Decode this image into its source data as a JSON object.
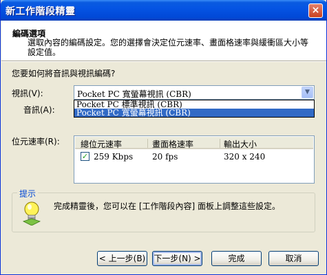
{
  "window": {
    "title": "新工作階段精靈",
    "close_glyph": "×"
  },
  "header": {
    "title": "編碼選項",
    "description": "選取內容的編碼設定。您的選擇會決定位元速率、畫面格速率與緩衝區大小等設定值。"
  },
  "question": "您要如何將音訊與視訊編碼?",
  "video": {
    "label": "視訊(V):",
    "selected": "Pocket PC 寬螢幕視訊 (CBR)",
    "options": [
      "Pocket PC 標準視訊 (CBR)",
      "Pocket PC 寬螢幕視訊 (CBR)"
    ]
  },
  "audio": {
    "label": "音訊(A):"
  },
  "bitrate": {
    "label": "位元速率(R):",
    "columns": [
      "總位元速率",
      "畫面格速率",
      "輸出大小"
    ],
    "rows": [
      {
        "checked": true,
        "total": "259 Kbps",
        "fps": "20 fps",
        "size": "320 x 240"
      }
    ]
  },
  "tip": {
    "label": "提示",
    "text": "完成精靈後，您可以在 [工作階段內容] 面板上調整這些設定。"
  },
  "buttons": {
    "back": "< 上一步(B)",
    "next": "下一步(N) >",
    "finish": "完成",
    "cancel": "取消"
  },
  "colors": {
    "titlebar": "#0554E3",
    "selection": "#316AC5",
    "tip_label": "#0046D5"
  }
}
